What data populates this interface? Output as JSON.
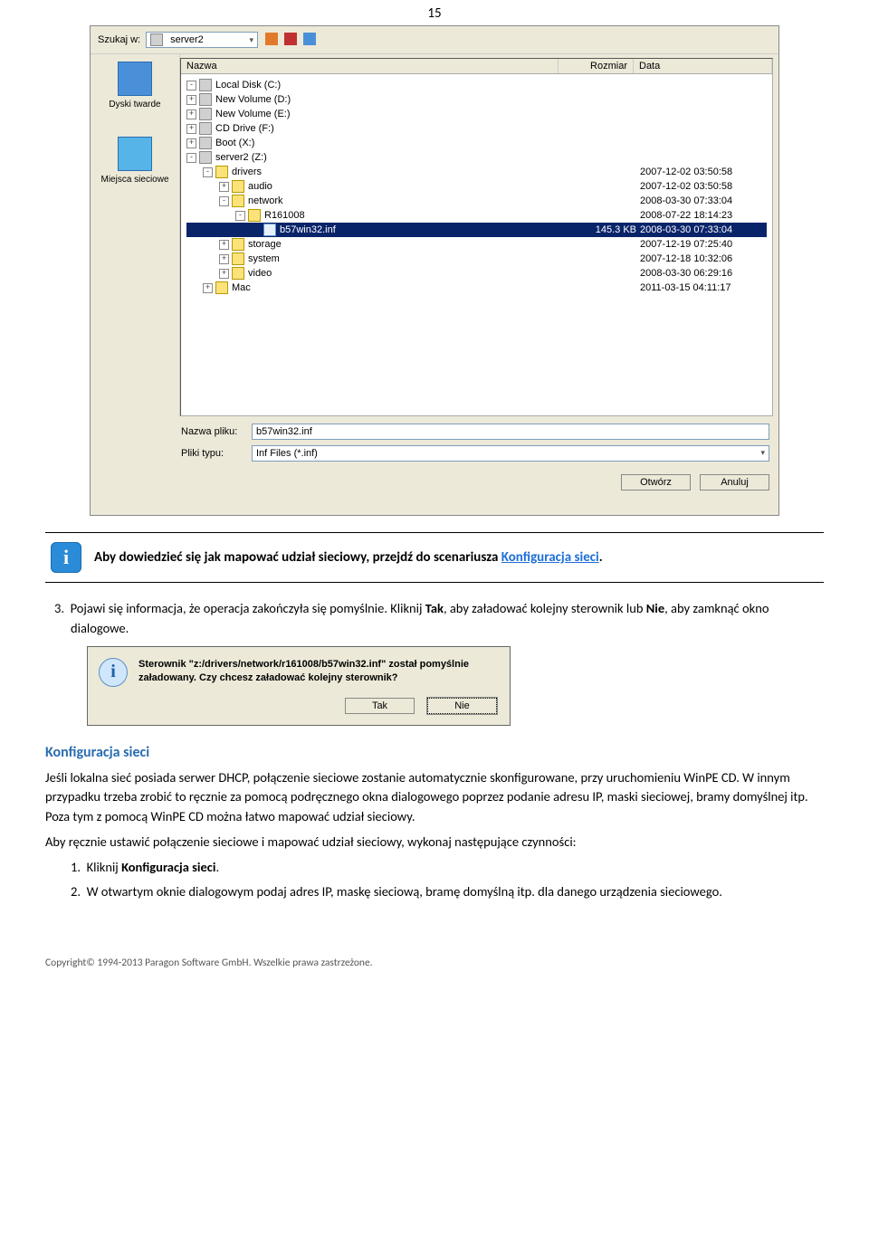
{
  "page_number": "15",
  "file_dialog": {
    "search_in_label": "Szukaj w:",
    "search_in_value": "server2",
    "sidebar": {
      "disks": "Dyski twarde",
      "network": "Miejsca sieciowe"
    },
    "columns": {
      "name": "Nazwa",
      "size": "Rozmiar",
      "date": "Data"
    },
    "tree": [
      {
        "indent": 0,
        "expander": "-",
        "icon": "drive",
        "label": "Local Disk (C:)",
        "size": "",
        "date": ""
      },
      {
        "indent": 0,
        "expander": "+",
        "icon": "drive",
        "label": "New Volume (D:)",
        "size": "",
        "date": ""
      },
      {
        "indent": 0,
        "expander": "+",
        "icon": "drive",
        "label": "New Volume (E:)",
        "size": "",
        "date": ""
      },
      {
        "indent": 0,
        "expander": "+",
        "icon": "drive",
        "label": "CD Drive (F:)",
        "size": "",
        "date": ""
      },
      {
        "indent": 0,
        "expander": "+",
        "icon": "drive",
        "label": "Boot (X:)",
        "size": "",
        "date": ""
      },
      {
        "indent": 0,
        "expander": "-",
        "icon": "drive",
        "label": "server2 (Z:)",
        "size": "",
        "date": ""
      },
      {
        "indent": 1,
        "expander": "-",
        "icon": "folder",
        "label": "drivers",
        "size": "",
        "date": "2007-12-02 03:50:58"
      },
      {
        "indent": 2,
        "expander": "+",
        "icon": "folder",
        "label": "audio",
        "size": "",
        "date": "2007-12-02 03:50:58"
      },
      {
        "indent": 2,
        "expander": "-",
        "icon": "folder",
        "label": "network",
        "size": "",
        "date": "2008-03-30 07:33:04"
      },
      {
        "indent": 3,
        "expander": "-",
        "icon": "folder",
        "label": "R161008",
        "size": "",
        "date": "2008-07-22 18:14:23"
      },
      {
        "indent": 4,
        "expander": "",
        "icon": "inf",
        "label": "b57win32.inf",
        "size": "145.3 KB",
        "date": "2008-03-30 07:33:04",
        "selected": true
      },
      {
        "indent": 2,
        "expander": "+",
        "icon": "folder",
        "label": "storage",
        "size": "",
        "date": "2007-12-19 07:25:40"
      },
      {
        "indent": 2,
        "expander": "+",
        "icon": "folder",
        "label": "system",
        "size": "",
        "date": "2007-12-18 10:32:06"
      },
      {
        "indent": 2,
        "expander": "+",
        "icon": "folder",
        "label": "video",
        "size": "",
        "date": "2008-03-30 06:29:16"
      },
      {
        "indent": 1,
        "expander": "+",
        "icon": "folder",
        "label": "Mac",
        "size": "",
        "date": "2011-03-15 04:11:17"
      }
    ],
    "filename_label": "Nazwa pliku:",
    "filename_value": "b57win32.inf",
    "filetype_label": "Pliki typu:",
    "filetype_value": "Inf Files (*.inf)",
    "open_button": "Otwórz",
    "cancel_button": "Anuluj"
  },
  "info_note": {
    "text_prefix": "Aby dowiedzieć się jak mapować udział sieciowy, przejdź do scenariusza ",
    "link_text": "Konfiguracja sieci",
    "text_suffix": "."
  },
  "step3": {
    "number": "3.",
    "text": "Pojawi się informacja, że operacja zakończyła się pomyślnie. Kliknij ",
    "bold1": "Tak",
    "mid": ", aby załadować kolejny sterownik lub ",
    "bold2": "Nie",
    "end": ", aby zamknąć okno dialogowe."
  },
  "msgbox": {
    "text": "Sterownik \"z:/drivers/network/r161008/b57win32.inf\" został pomyślnie załadowany. Czy chcesz załadować kolejny sterownik?",
    "yes": "Tak",
    "no": "Nie"
  },
  "section": {
    "title": "Konfiguracja sieci",
    "para1": "Jeśli lokalna sieć posiada serwer DHCP, połączenie sieciowe zostanie automatycznie skonfigurowane, przy uruchomieniu WinPE CD. W innym przypadku trzeba zrobić to ręcznie za pomocą podręcznego okna dialogowego poprzez podanie adresu IP, maski sieciowej, bramy domyślnej itp. Poza tym z pomocą WinPE CD można łatwo mapować udział sieciowy.",
    "para2": "Aby ręcznie ustawić połączenie sieciowe i mapować udział sieciowy, wykonaj następujące czynności:",
    "step1_num": "1.",
    "step1_pre": "Kliknij ",
    "step1_bold": "Konfiguracja sieci",
    "step1_post": ".",
    "step2_num": "2.",
    "step2": "W otwartym oknie dialogowym podaj adres IP, maskę sieciową, bramę domyślną itp. dla danego urządzenia sieciowego."
  },
  "footer": "Copyright© 1994-2013 Paragon Software GmbH. Wszelkie prawa zastrzeżone."
}
